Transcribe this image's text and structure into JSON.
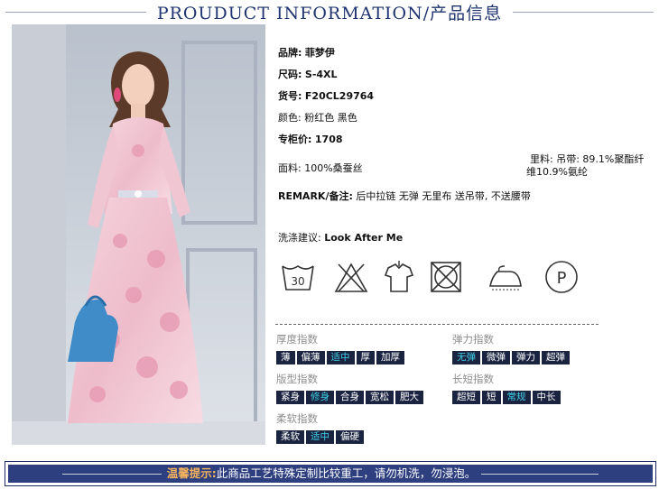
{
  "header": {
    "title": "PROUDUCT INFORMATION/产品信息"
  },
  "product": {
    "brand_label": "品牌:",
    "brand": "菲梦伊",
    "size_label": "尺码:",
    "size": "S-4XL",
    "code_label": "货号:",
    "code": "F20CL29764",
    "color_label": "颜色:",
    "color": "粉红色 黑色",
    "price_label": "专柜价:",
    "price": "1708",
    "fabric_label": "面料:",
    "fabric": "100%桑蚕丝",
    "lining_label": "里料:",
    "lining_line1": "吊带: 89.1%聚酯纤",
    "lining_line2": "维10.9%氨纶",
    "remark_label": "REMARK/备注:",
    "remark": "后中拉链 无弹 无里布 送吊带, 不送腰带",
    "wash_label": "洗涤建议:",
    "wash": "Look After Me"
  },
  "care_icons": {
    "wash_temp": "30",
    "iron_label": "P",
    "icons": [
      "wash-30-icon",
      "no-bleach-icon",
      "hang-dry-icon",
      "no-tumble-dry-icon",
      "iron-low-icon",
      "professional-clean-p-icon"
    ]
  },
  "indices": {
    "thickness": {
      "title": "厚度指数",
      "options": [
        "薄",
        "偏薄",
        "适中",
        "厚",
        "加厚"
      ],
      "selected": 2
    },
    "elasticity": {
      "title": "弹力指数",
      "options": [
        "无弹",
        "微弹",
        "弹力",
        "超弹"
      ],
      "selected": 0
    },
    "fit": {
      "title": "版型指数",
      "options": [
        "紧身",
        "修身",
        "合身",
        "宽松",
        "肥大"
      ],
      "selected": 1
    },
    "length": {
      "title": "长短指数",
      "options": [
        "超短",
        "短",
        "常规",
        "中长"
      ],
      "selected": 2
    },
    "softness": {
      "title": "柔软指数",
      "options": [
        "柔软",
        "适中",
        "偏硬"
      ],
      "selected": 1
    }
  },
  "notice": {
    "tip": "温馨提示:",
    "text": "此商品工艺特殊定制比较重工，请勿机洗，勿浸泡。"
  },
  "colors": {
    "navy": "#1a2340",
    "highlight": "#3fd0e6",
    "banner": "#2e3f80",
    "tip": "#f4b35c",
    "header": "#1f3470"
  }
}
